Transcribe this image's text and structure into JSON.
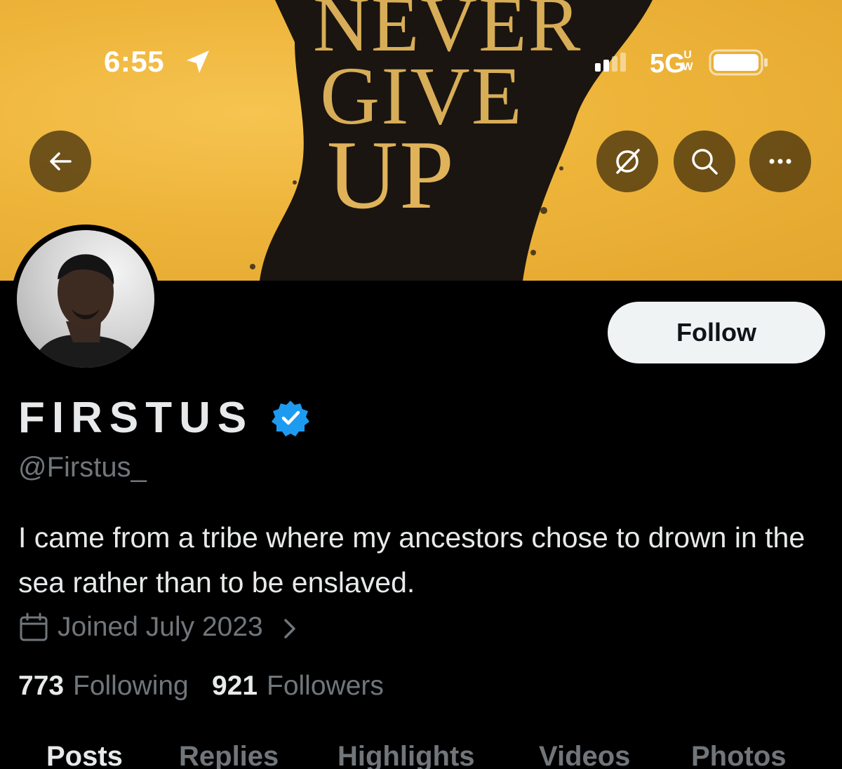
{
  "status_bar": {
    "time": "6:55",
    "network": "5G",
    "network_sub": "UW",
    "icons": [
      "location-arrow-icon",
      "cellular-signal-icon",
      "battery-icon"
    ]
  },
  "banner": {
    "line1": "NEVER",
    "line2": "GIVE",
    "line3": "UP",
    "background_color": "#eeb43a"
  },
  "header_buttons": {
    "back": "arrow-left-icon",
    "grok": "grok-icon",
    "search": "search-icon",
    "more": "more-horizontal-icon"
  },
  "profile": {
    "display_name": "FIRSTUS",
    "handle": "@Firstus_",
    "verified": true,
    "bio": "I came from a tribe where my ancestors chose to drown in the sea rather than to be enslaved.",
    "joined": "Joined July 2023",
    "following_count": "773",
    "following_label": "Following",
    "followers_count": "921",
    "followers_label": "Followers"
  },
  "actions": {
    "follow_label": "Follow"
  },
  "tabs": [
    {
      "label": "Posts",
      "active": true
    },
    {
      "label": "Replies",
      "active": false
    },
    {
      "label": "Highlights",
      "active": false
    },
    {
      "label": "Videos",
      "active": false
    },
    {
      "label": "Photos",
      "active": false
    }
  ],
  "colors": {
    "background": "#000000",
    "text_primary": "#e7e9ea",
    "text_secondary": "#71767b",
    "verified_blue": "#1d9bf0",
    "follow_button_bg": "#eff3f4"
  }
}
